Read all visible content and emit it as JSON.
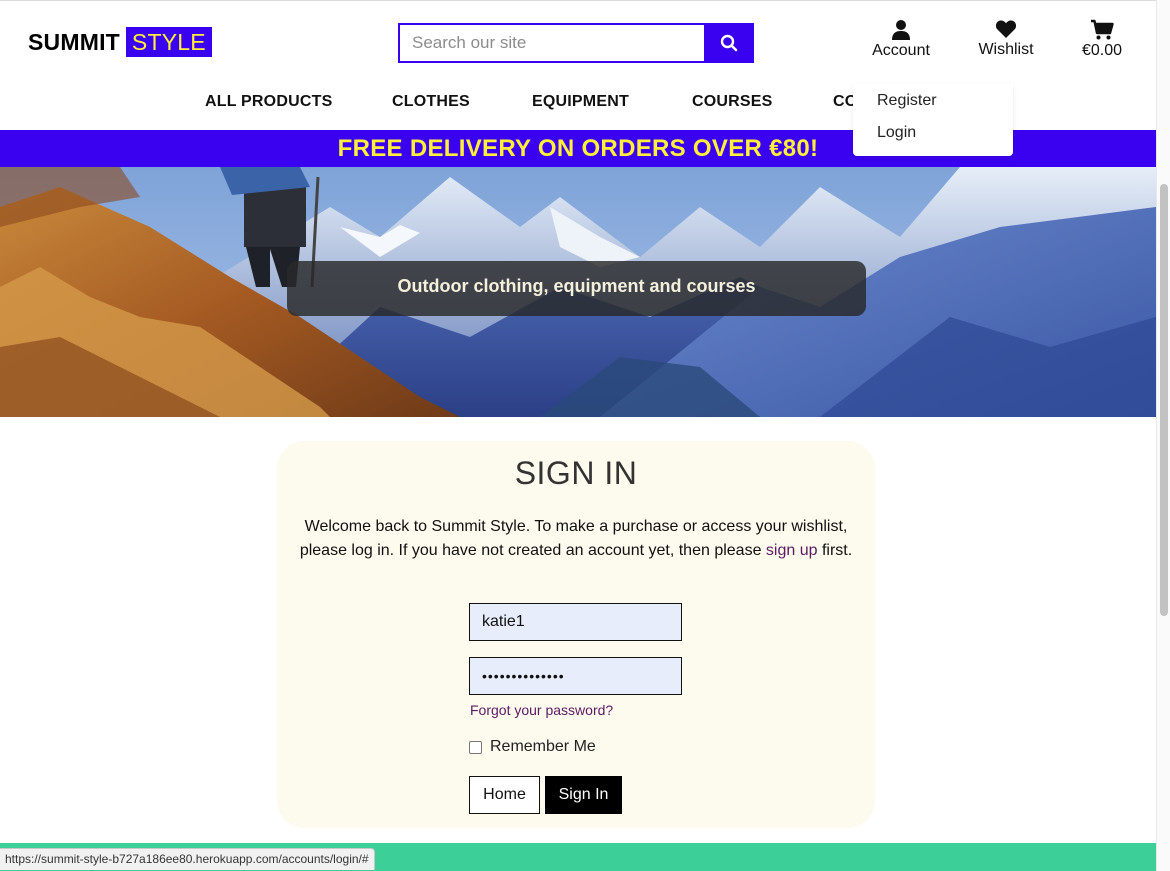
{
  "brand": {
    "part1": "SUMMIT",
    "part2": "STYLE",
    "accent_color": "#3a00f0",
    "highlight_color": "#ffef3a"
  },
  "search": {
    "placeholder": "Search our site",
    "value": ""
  },
  "header_icons": {
    "account": {
      "label": "Account",
      "icon": "user-icon"
    },
    "wishlist": {
      "label": "Wishlist",
      "icon": "heart-icon"
    },
    "cart": {
      "label": "€0.00",
      "icon": "cart-icon"
    }
  },
  "nav": {
    "items": [
      {
        "label": "ALL PRODUCTS"
      },
      {
        "label": "CLOTHES"
      },
      {
        "label": "EQUIPMENT"
      },
      {
        "label": "COURSES"
      },
      {
        "label": "CO"
      }
    ]
  },
  "account_menu": {
    "items": [
      {
        "label": "Register"
      },
      {
        "label": "Login"
      }
    ]
  },
  "banner": {
    "text": "FREE DELIVERY ON ORDERS OVER €80!"
  },
  "hero": {
    "caption": "Outdoor clothing, equipment and courses"
  },
  "signin": {
    "title": "SIGN IN",
    "intro_before": "Welcome back to Summit Style. To make a purchase or access your wishlist, please log in. If you have not created an account yet, then please ",
    "signup_link": "sign up",
    "intro_after": " first.",
    "username_value": "katie1",
    "password_mask": "••••••••••••••",
    "forgot_link": "Forgot your password?",
    "remember_label": "Remember Me",
    "remember_checked": false,
    "home_button": "Home",
    "signin_button": "Sign In"
  },
  "status_bar": {
    "url": "https://summit-style-b727a186ee80.herokuapp.com/accounts/login/#"
  },
  "colors": {
    "footer": "#3ccf98",
    "card_bg": "#fdfaee",
    "link": "#5b1a62"
  }
}
